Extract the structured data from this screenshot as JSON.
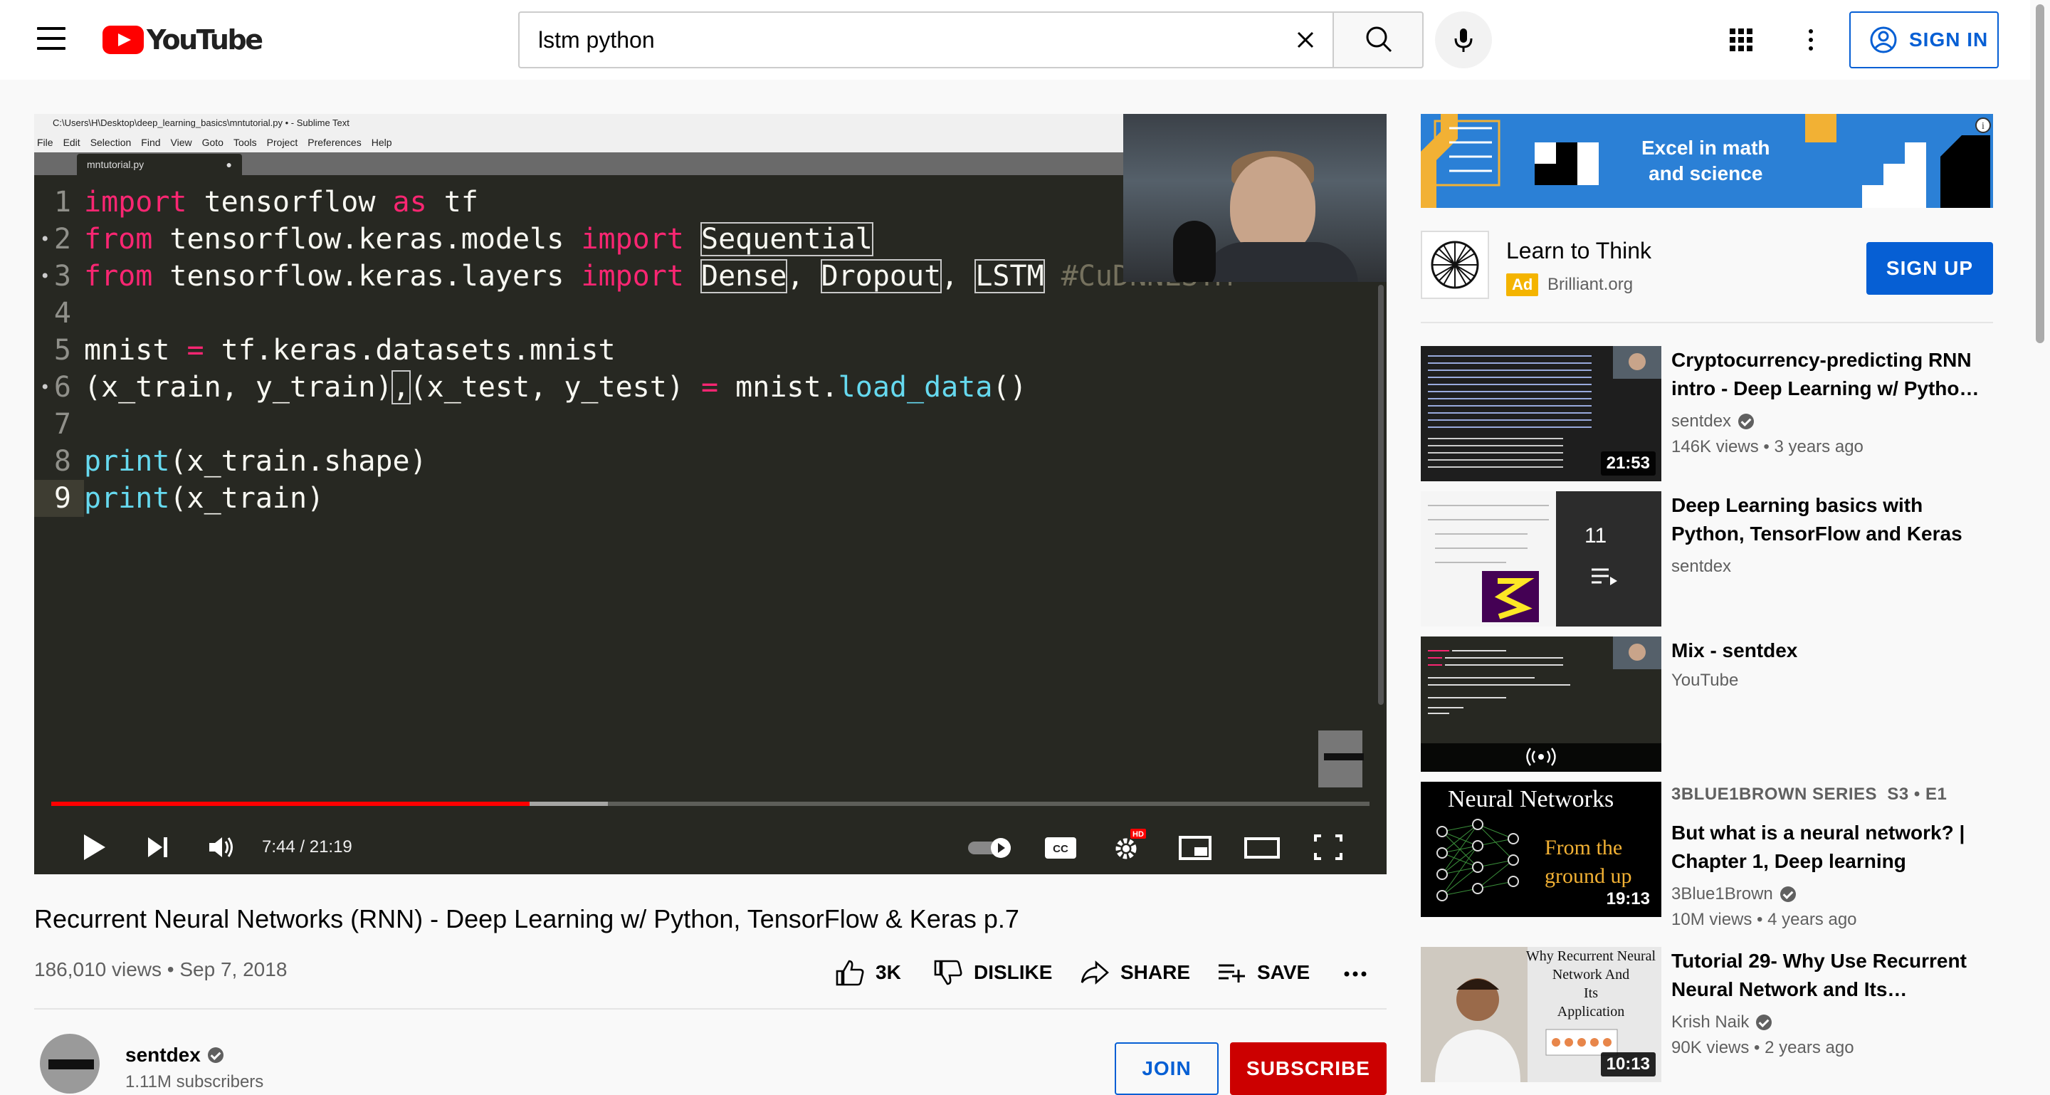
{
  "header": {
    "logo_text": "YouTube",
    "search_value": "lstm python",
    "signin_label": "SIGN IN"
  },
  "player": {
    "window_title": "C:\\Users\\H\\Desktop\\deep_learning_basics\\mntutorial.py • - Sublime Text",
    "menu": [
      "File",
      "Edit",
      "Selection",
      "Find",
      "View",
      "Goto",
      "Tools",
      "Project",
      "Preferences",
      "Help"
    ],
    "tab_name": "mntutorial.py",
    "time": "7:44 / 21:19",
    "progress_fraction": 0.363,
    "buffered_fraction": 0.422,
    "code_lines": [
      "1",
      "2",
      "3",
      "4",
      "5",
      "6",
      "7",
      "8",
      "9"
    ],
    "code_text": {
      "l1_import": "import",
      "l1_mod": " tensorflow ",
      "l1_as": "as",
      "l1_alias": " tf",
      "l2_from": "from",
      "l2_mod": " tensorflow.keras.models ",
      "l2_import": "import",
      "l2_name": "Sequential",
      "l3_from": "from",
      "l3_mod": " tensorflow.keras.layers ",
      "l3_import": "import",
      "l3_a": "Dense",
      "l3_b": "Dropout",
      "l3_c": "LSTM",
      "l3_comment": "#CuDNNLSTM",
      "l5_var": "mnist ",
      "l5_eq": "=",
      "l5_rest": " tf.keras.datasets.mnist",
      "l6_a": "(x_train, y_train)",
      "l6_b": "(x_test, y_test) ",
      "l6_eq": "=",
      "l6_c": " mnist.",
      "l6_fn": "load_data",
      "l6_d": "()",
      "l8_fn": "print",
      "l8_rest": "(x_train.shape)",
      "l9_fn": "print",
      "l9_rest": "(x_train)"
    }
  },
  "video": {
    "title": "Recurrent Neural Networks (RNN) - Deep Learning w/ Python, TensorFlow & Keras p.7",
    "meta": "186,010 views • Sep 7, 2018",
    "likes": "3K",
    "dislike_label": "DISLIKE",
    "share_label": "SHARE",
    "save_label": "SAVE"
  },
  "channel": {
    "name": "sentdex",
    "subs": "1.11M subscribers",
    "join_label": "JOIN",
    "subscribe_label": "SUBSCRIBE"
  },
  "ad": {
    "banner_text_1": "Excel in math",
    "banner_text_2": "and science",
    "title": "Learn to Think",
    "badge": "Ad",
    "domain": "Brilliant.org",
    "cta": "SIGN UP"
  },
  "recommendations": [
    {
      "title": "Cryptocurrency-predicting RNN intro - Deep Learning w/ Pytho…",
      "channel": "sentdex",
      "meta": "146K views • 3 years ago",
      "duration": "21:53"
    },
    {
      "title": "Deep Learning basics with Python, TensorFlow and Keras",
      "channel": "sentdex",
      "playlist_count": "11"
    },
    {
      "title": "Mix - sentdex",
      "channel": "YouTube"
    },
    {
      "series": "3BLUE1BROWN SERIES  S3 • E1",
      "title": "But what is a neural network? | Chapter 1, Deep learning",
      "channel": "3Blue1Brown",
      "meta": "10M views • 4 years ago",
      "duration": "19:13",
      "thumb_title": "Neural Networks",
      "thumb_sub_1": "From the",
      "thumb_sub_2": "ground up"
    },
    {
      "title": "Tutorial 29- Why Use Recurrent Neural Network and Its…",
      "channel": "Krish Naik",
      "meta": "90K views • 2 years ago",
      "duration": "10:13",
      "thumb_text_1": "Why Recurrent Neural",
      "thumb_text_2": "Network And",
      "thumb_text_3": "Its",
      "thumb_text_4": "Application"
    }
  ],
  "colors": {
    "accent": "#065fd4",
    "brand": "#ff0000",
    "subscribe": "#cc0000"
  }
}
